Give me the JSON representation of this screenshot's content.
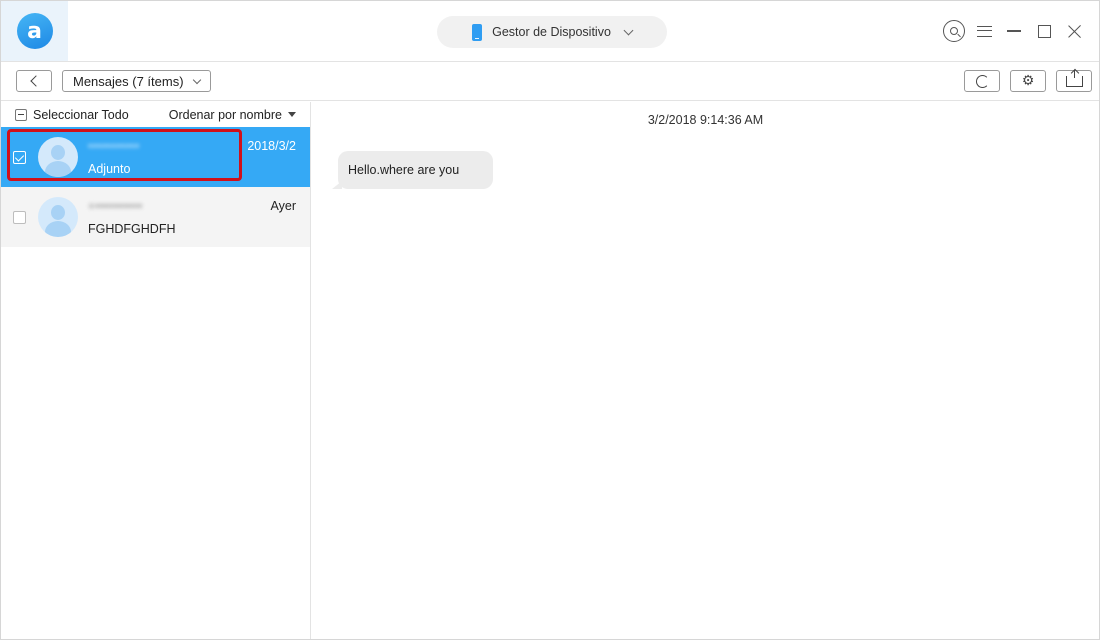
{
  "header": {
    "device_label": "Gestor de Dispositivo"
  },
  "toolbar": {
    "category_label": "Mensajes (7 ítems)"
  },
  "list": {
    "select_all_label": "Seleccionar Todo",
    "sort_label": "Ordenar por nombre",
    "conversations": [
      {
        "name": "(blurred contact)",
        "preview": "Adjunto",
        "date": "2018/3/2",
        "selected": true
      },
      {
        "name": "(blurred contact)",
        "preview": "FGHDFGHDFH",
        "date": "Ayer",
        "selected": false
      }
    ]
  },
  "messages": {
    "timestamp": "3/2/2018 9:14:36 AM",
    "items": [
      {
        "text": "Hello.where are you",
        "direction": "incoming"
      }
    ]
  },
  "colors": {
    "accent": "#35a9f5",
    "highlight": "#d0101a",
    "bubble": "#ececec"
  }
}
